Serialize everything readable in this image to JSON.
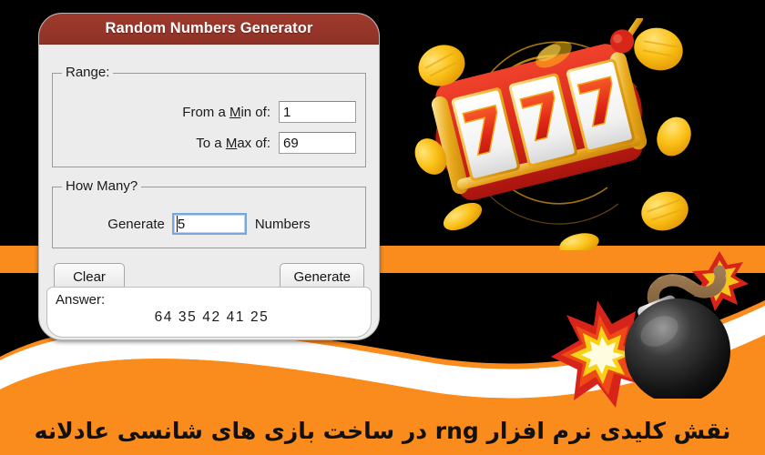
{
  "page": {
    "background_color": "#000000",
    "accent_orange": "#FA8C1E",
    "title_bar_color": "#96352A"
  },
  "dialog": {
    "title": "Random Numbers Generator",
    "range_group": {
      "legend": "Range:",
      "fields": [
        {
          "label_before": "From a ",
          "mnemonic": "M",
          "label_after": "in of:",
          "value": "1"
        },
        {
          "label_before": "To a ",
          "mnemonic": "M",
          "label_after": "ax of:",
          "value": "69"
        }
      ]
    },
    "how_many_group": {
      "legend": "How Many?",
      "label_before": "Generate",
      "label_after": "Numbers",
      "value": "5"
    },
    "buttons": {
      "clear": "Clear",
      "generate": "Generate"
    },
    "answer": {
      "label": "Answer:",
      "values": "64  35  42  41  25"
    }
  },
  "artwork": {
    "slot_machine": {
      "name": "slot-machine-777",
      "reels": [
        "7",
        "7",
        "7"
      ],
      "body_color": "#E02718",
      "trim_color": "#F2B33A",
      "seven_color": "#E53416",
      "coin_color": "#FCC417"
    },
    "bomb": {
      "name": "bomb-with-lit-fuse",
      "body_color": "#1C1C1C",
      "fuse_color": "#B08A5A",
      "spark_color": "#F5C518"
    },
    "explosion": {
      "name": "explosion-burst",
      "outer_color": "#D7241B",
      "inner_color": "#F7D117"
    }
  },
  "caption": {
    "text": "نقش کلیدی نرم افزار rng در ساخت بازی های شانسی عادلانه"
  }
}
